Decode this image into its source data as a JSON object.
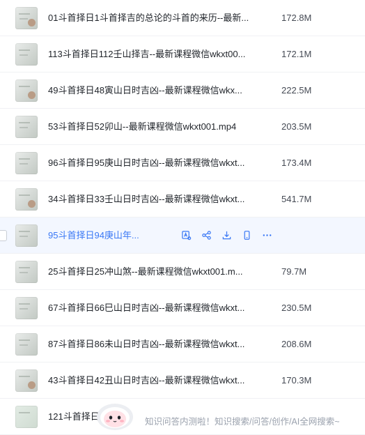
{
  "files": [
    {
      "name": "01斗首择日1斗首择吉的总论的斗首的来历--最新...",
      "size": "172.8M"
    },
    {
      "name": "113斗首择日112壬山择吉--最新课程微信wkxt00...",
      "size": "172.1M"
    },
    {
      "name": "49斗首择日48寅山日时吉凶--最新课程微信wkx...",
      "size": "222.5M"
    },
    {
      "name": "53斗首择日52卯山--最新课程微信wkxt001.mp4",
      "size": "203.5M"
    },
    {
      "name": "96斗首择日95庚山日时吉凶--最新课程微信wkxt...",
      "size": "173.4M"
    },
    {
      "name": "34斗首择日33壬山日时吉凶--最新课程微信wkxt...",
      "size": "541.7M"
    },
    {
      "name": "95斗首择日94庚山年...",
      "size": "",
      "selected": true
    },
    {
      "name": "25斗首择日25冲山煞--最新课程微信wkxt001.m...",
      "size": "79.7M"
    },
    {
      "name": "67斗首择日66巳山日时吉凶--最新课程微信wkxt...",
      "size": "230.5M"
    },
    {
      "name": "87斗首择日86未山日时吉凶--最新课程微信wkxt...",
      "size": "208.6M"
    },
    {
      "name": "43斗首择日42丑山日时吉凶--最新课程微信wkxt...",
      "size": "170.3M"
    },
    {
      "name": "121斗首择日",
      "size": ""
    }
  ],
  "selected_actions": [
    {
      "icon": "ai-summary-icon"
    },
    {
      "icon": "share-icon"
    },
    {
      "icon": "download-icon"
    },
    {
      "icon": "mobile-icon"
    },
    {
      "icon": "more-icon"
    }
  ],
  "ai_assistant": {
    "prompt": "知识问答内测啦！知识搜索/问答/创作/AI全网搜索~"
  },
  "colors": {
    "accent": "#3a78f5",
    "text": "#1f2329",
    "muted": "#9aa1ad"
  }
}
